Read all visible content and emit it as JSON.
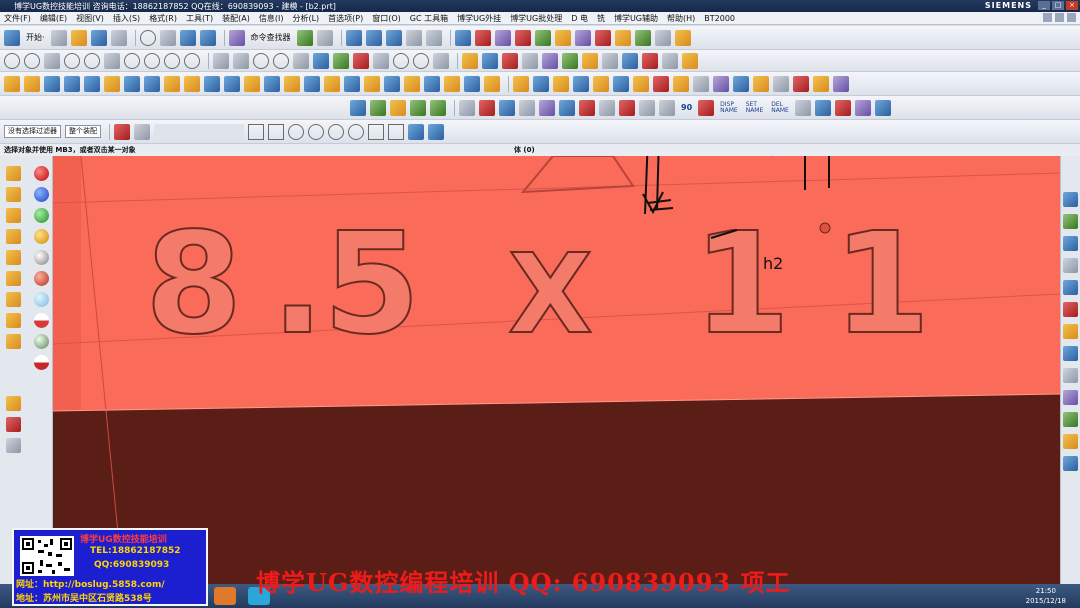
{
  "window": {
    "title": "博学UG数控技能培训 咨询电话：18862187852 QQ在线：690839093 - 建模 - [b2.prt]",
    "brand": "SIEMENS"
  },
  "menu": {
    "items": [
      "文件(F)",
      "编辑(E)",
      "视图(V)",
      "插入(S)",
      "格式(R)",
      "工具(T)",
      "装配(A)",
      "信息(I)",
      "分析(L)",
      "首选项(P)",
      "窗口(O)",
      "GC 工具箱",
      "博学UG外挂",
      "博学UG批处理",
      "D 电",
      "铣",
      "博学UG辅助",
      "帮助(H)",
      "BT2000"
    ]
  },
  "toolbar": {
    "start_label": "开始·",
    "command_finder": "命令查找器"
  },
  "cmd_buttons": {
    "disp": "DISP\nNAME",
    "set": "SET\nNAME",
    "del": "DEL\nNAME",
    "n90": "90"
  },
  "selection": {
    "filter": "没有选择过滤器",
    "scope": "整个装配"
  },
  "prompt": {
    "text": "选择对象并使用 MB3，或者双击某一对象",
    "status": "体 (0)"
  },
  "viewport": {
    "engraving": [
      "8",
      ".",
      "5",
      "X",
      "1",
      "1"
    ],
    "annotation": "h2"
  },
  "ad": {
    "line1": "博学UG数控技能培训",
    "line2": "TEL:18862187852",
    "line3": "QQ:690839093",
    "line4": "网址：http://boslug.5858.com/",
    "line5": "地址：苏州市吴中区石贤路538号"
  },
  "banner": "博学UG数控编程培训  QQ: 690839093  项工",
  "clock": {
    "time": "21:50",
    "date": "2015/12/18"
  },
  "colors": {
    "part_face": "#fa6b5a",
    "part_shadow": "#5a1e17",
    "banner_red": "#ee1b1b",
    "ad_blue": "#1c1fd0"
  }
}
